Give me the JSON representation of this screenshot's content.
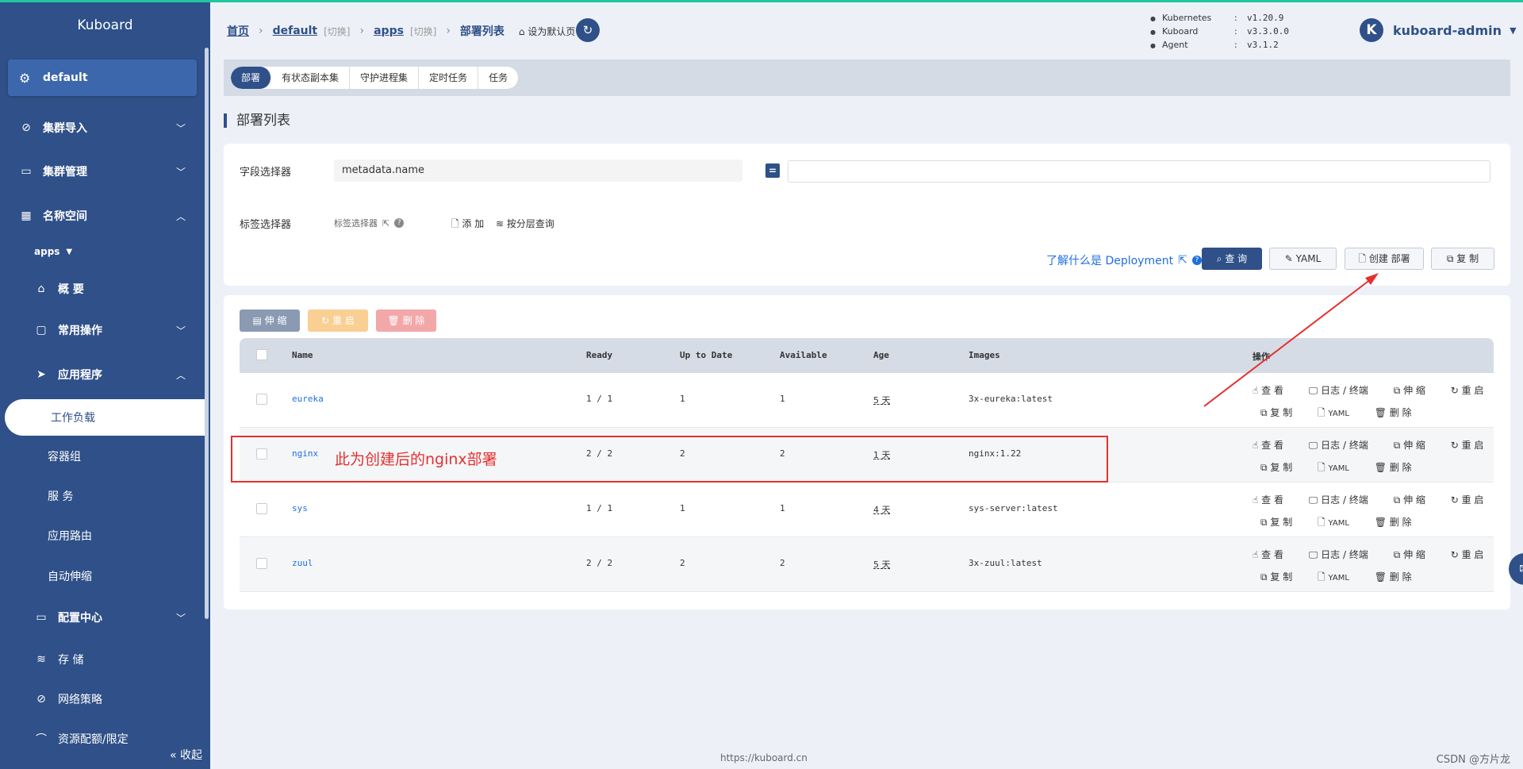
{
  "sidebar": {
    "title": "Kuboard",
    "namespace": "default",
    "items": [
      {
        "label": "集群导入"
      },
      {
        "label": "集群管理"
      },
      {
        "label": "名称空间"
      }
    ],
    "ns_name": "apps",
    "sub": {
      "overview": "概 要",
      "common": "常用操作",
      "apps": "应用程序",
      "workload": "工作负载",
      "pods": "容器组",
      "services": "服 务",
      "ingress": "应用路由",
      "autoscale": "自动伸缩",
      "config": "配置中心",
      "storage": "存 储",
      "netpolicy": "网络策略",
      "quota": "资源配额/限定"
    },
    "collapse": "收起"
  },
  "breadcrumb": {
    "home": "首页",
    "ns": "default",
    "switch": "[切换]",
    "app": "apps",
    "current": "部署列表",
    "set_default": "设为默认页"
  },
  "versions": [
    {
      "k": "Kubernetes",
      "v": "v1.20.9"
    },
    {
      "k": "Kuboard",
      "v": "v3.3.0.0"
    },
    {
      "k": "Agent",
      "v": "v3.1.2"
    }
  ],
  "user": {
    "avatar": "K",
    "name": "kuboard-admin"
  },
  "tabs": [
    "部署",
    "有状态副本集",
    "守护进程集",
    "定时任务",
    "任务"
  ],
  "page_title": "部署列表",
  "filter": {
    "field_label": "字段选择器",
    "field_value": "metadata.name",
    "eq": "=",
    "label_label": "标签选择器",
    "label_selector": "标签选择器",
    "add": "添 加",
    "layer_query": "按分层查询",
    "learn": "了解什么是 Deployment",
    "btn_query": "查 询",
    "btn_yaml": "YAML",
    "btn_create": "创建 部署",
    "btn_copy": "复 制"
  },
  "actions": {
    "scale": "伸 缩",
    "restart": "重 启",
    "delete": "删 除"
  },
  "table": {
    "headers": [
      "Name",
      "Ready",
      "Up to Date",
      "Available",
      "Age",
      "Images",
      "操作"
    ],
    "rows": [
      {
        "name": "eureka",
        "ready": "1 / 1",
        "uptodate": "1",
        "available": "1",
        "age": "5 天",
        "image": "3x-eureka:latest"
      },
      {
        "name": "nginx",
        "ready": "2 / 2",
        "uptodate": "2",
        "available": "2",
        "age": "1 天",
        "image": "nginx:1.22"
      },
      {
        "name": "sys",
        "ready": "1 / 1",
        "uptodate": "1",
        "available": "1",
        "age": "4 天",
        "image": "sys-server:latest"
      },
      {
        "name": "zuul",
        "ready": "2 / 2",
        "uptodate": "2",
        "available": "2",
        "age": "5 天",
        "image": "3x-zuul:latest"
      }
    ],
    "ops": {
      "view": "查 看",
      "logs": "日志 / 终端",
      "scale": "伸 缩",
      "restart": "重 启",
      "copy": "复 制",
      "yaml": "YAML",
      "delete": "删 除"
    }
  },
  "annotation": "此为创建后的nginx部署",
  "footer": "https://kuboard.cn",
  "watermark": "CSDN @方片龙",
  "colors": {
    "primary": "#2f5088",
    "accent": "#1f6fe0",
    "annotation": "#e53030"
  }
}
